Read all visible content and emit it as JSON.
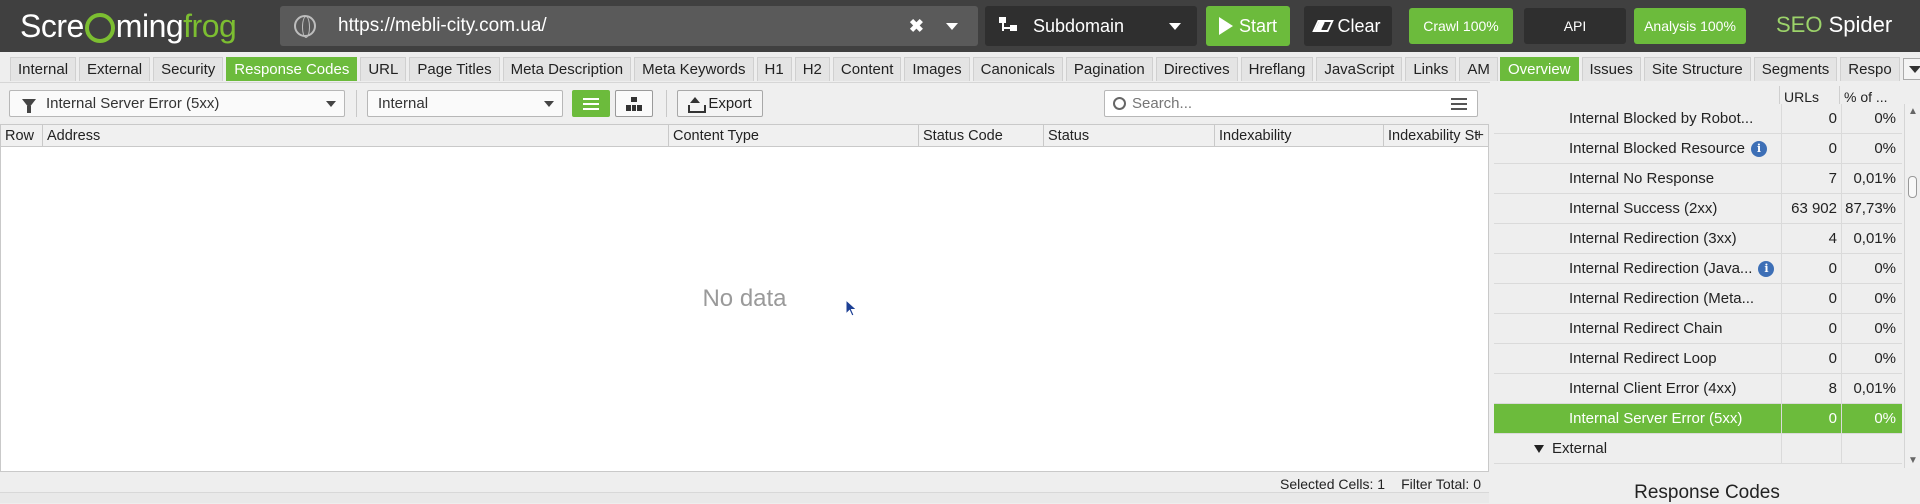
{
  "app": {
    "logo_prefix": "Scre",
    "logo_middle": "ming",
    "logo_suffix": "frog",
    "brand_seo": "SEO",
    "brand_spider": "Spider"
  },
  "topbar": {
    "url": "https://mebli-city.com.ua/",
    "mode": "Subdomain",
    "start_label": "Start",
    "clear_label": "Clear",
    "crawl_label": "Crawl 100%",
    "api_label": "API",
    "analysis_label": "Analysis 100%"
  },
  "tabs": [
    "Internal",
    "External",
    "Security",
    "Response Codes",
    "URL",
    "Page Titles",
    "Meta Description",
    "Meta Keywords",
    "H1",
    "H2",
    "Content",
    "Images",
    "Canonicals",
    "Pagination",
    "Directives",
    "Hreflang",
    "JavaScript",
    "Links",
    "AM"
  ],
  "active_tab": "Response Codes",
  "filterbar": {
    "filter": "Internal Server Error (5xx)",
    "scope": "Internal",
    "export_label": "Export",
    "search_placeholder": "Search..."
  },
  "grid": {
    "columns": [
      "Row",
      "Address",
      "Content Type",
      "Status Code",
      "Status",
      "Indexability",
      "Indexability St"
    ],
    "empty_message": "No data",
    "status": {
      "selected_cells_label": "Selected Cells:",
      "selected_cells_value": "1",
      "filter_total_label": "Filter Total:",
      "filter_total_value": "0"
    }
  },
  "right": {
    "tabs": [
      "Overview",
      "Issues",
      "Site Structure",
      "Segments",
      "Respo"
    ],
    "active_tab": "Overview",
    "header": {
      "urls": "URLs",
      "pct": "% of ..."
    },
    "rows": [
      {
        "name": "Internal Blocked by Robot...",
        "urls": "0",
        "pct": "0%",
        "info": false
      },
      {
        "name": "Internal Blocked Resource",
        "urls": "0",
        "pct": "0%",
        "info": true
      },
      {
        "name": "Internal No Response",
        "urls": "7",
        "pct": "0,01%",
        "info": false
      },
      {
        "name": "Internal Success (2xx)",
        "urls": "63 902",
        "pct": "87,73%",
        "info": false
      },
      {
        "name": "Internal Redirection (3xx)",
        "urls": "4",
        "pct": "0,01%",
        "info": false
      },
      {
        "name": "Internal Redirection (Java...",
        "urls": "0",
        "pct": "0%",
        "info": true
      },
      {
        "name": "Internal Redirection (Meta...",
        "urls": "0",
        "pct": "0%",
        "info": false
      },
      {
        "name": "Internal Redirect Chain",
        "urls": "0",
        "pct": "0%",
        "info": false
      },
      {
        "name": "Internal Redirect Loop",
        "urls": "0",
        "pct": "0%",
        "info": false
      },
      {
        "name": "Internal Client Error (4xx)",
        "urls": "8",
        "pct": "0,01%",
        "info": false
      },
      {
        "name": "Internal Server Error (5xx)",
        "urls": "0",
        "pct": "0%",
        "info": false,
        "selected": true
      }
    ],
    "group_label": "External",
    "panel_title": "Response Codes"
  },
  "colors": {
    "accent_green": "#6cbb3c",
    "topbar": "#404040",
    "info_blue": "#3d6fb6"
  }
}
